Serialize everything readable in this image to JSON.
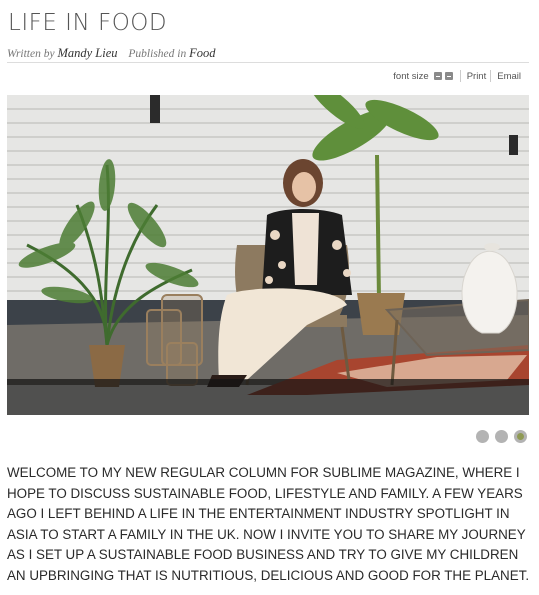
{
  "article": {
    "title": "LIFE IN FOOD",
    "byline": {
      "written_by_label": "Written by",
      "author": "Mandy Lieu",
      "published_in_label": "Published in",
      "section": "Food"
    },
    "tools": {
      "font_size_label": "font size",
      "decrease_icon": "minus-box-icon",
      "increase_icon": "minus-box-icon",
      "print_label": "Print",
      "email_label": "Email"
    },
    "slideshow": {
      "slide_count": 3,
      "active_index": 2
    },
    "intro": "WELCOME TO MY NEW REGULAR COLUMN FOR SUBLIME MAGAZINE, WHERE I HOPE TO DISCUSS SUSTAINABLE FOOD, LIFESTYLE AND FAMILY. A FEW YEARS AGO I LEFT BEHIND A LIFE IN THE ENTERTAINMENT INDUSTRY SPOTLIGHT IN ASIA TO START A FAMILY IN THE UK. NOW I INVITE YOU TO SHARE MY JOURNEY AS I SET UP A SUSTAINABLE FOOD BUSINESS AND TRY TO GIVE MY CHILDREN AN UPBRINGING THAT IS NUTRITIOUS, DELICIOUS AND GOOD FOR THE PLANET."
  },
  "colors": {
    "active_dot": "#8f9a54",
    "inactive_dot": "#b3b3b3"
  }
}
